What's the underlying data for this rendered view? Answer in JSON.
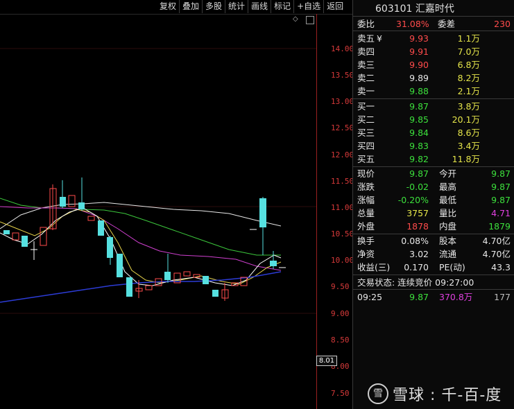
{
  "toolbar": {
    "items": [
      "复权",
      "叠加",
      "多股",
      "统计",
      "画线",
      "标记",
      "+自选",
      "返回"
    ]
  },
  "chart": {
    "y_labels": [
      "14.00",
      "13.50",
      "13.00",
      "12.50",
      "12.00",
      "11.50",
      "11.00",
      "10.50",
      "10.00",
      "9.50",
      "9.00",
      "8.50",
      "8.00",
      "7.50"
    ],
    "current_price_tag": "8.01"
  },
  "quote": {
    "title": "603101 汇嘉时代",
    "weibi_label": "委比",
    "weibi_value": "31.08%",
    "weicha_label": "委差",
    "weicha_value": "230",
    "asks": [
      {
        "label": "卖五",
        "mark": "¥",
        "price": "9.93",
        "vol": "1.1万",
        "price_color": "red"
      },
      {
        "label": "卖四",
        "mark": "",
        "price": "9.91",
        "vol": "7.0万",
        "price_color": "red"
      },
      {
        "label": "卖三",
        "mark": "",
        "price": "9.90",
        "vol": "6.8万",
        "price_color": "red"
      },
      {
        "label": "卖二",
        "mark": "",
        "price": "9.89",
        "vol": "8.2万",
        "price_color": "white"
      },
      {
        "label": "卖一",
        "mark": "",
        "price": "9.88",
        "vol": "2.1万",
        "price_color": "green"
      }
    ],
    "bids": [
      {
        "label": "买一",
        "price": "9.87",
        "vol": "3.8万"
      },
      {
        "label": "买二",
        "price": "9.85",
        "vol": "20.1万"
      },
      {
        "label": "买三",
        "price": "9.84",
        "vol": "8.6万"
      },
      {
        "label": "买四",
        "price": "9.83",
        "vol": "3.4万"
      },
      {
        "label": "买五",
        "price": "9.82",
        "vol": "11.8万"
      }
    ],
    "stats": [
      {
        "l1": "现价",
        "v1": "9.87",
        "c1": "green",
        "l2": "今开",
        "v2": "9.87",
        "c2": "green"
      },
      {
        "l1": "涨跌",
        "v1": "-0.02",
        "c1": "green",
        "l2": "最高",
        "v2": "9.87",
        "c2": "green"
      },
      {
        "l1": "涨幅",
        "v1": "-0.20%",
        "c1": "green",
        "l2": "最低",
        "v2": "9.87",
        "c2": "green"
      },
      {
        "l1": "总量",
        "v1": "3757",
        "c1": "yellow",
        "l2": "量比",
        "v2": "4.71",
        "c2": "magenta"
      },
      {
        "l1": "外盘",
        "v1": "1878",
        "c1": "red",
        "l2": "内盘",
        "v2": "1879",
        "c2": "green"
      }
    ],
    "stats2": [
      {
        "l1": "换手",
        "v1": "0.08%",
        "l2": "股本",
        "v2": "4.70亿"
      },
      {
        "l1": "净资",
        "v1": "3.02",
        "l2": "流通",
        "v2": "4.70亿"
      },
      {
        "l1": "收益(三)",
        "v1": "0.170",
        "l2": "PE(动)",
        "v2": "43.3"
      }
    ],
    "trade_status": "交易状态: 连续竞价 09:27:00",
    "tick": {
      "time": "09:25",
      "price": "9.87",
      "amount": "370.8万",
      "count": "177"
    }
  },
  "watermark": {
    "icon": "雪",
    "text": "雪球 : 千-百-度"
  }
}
